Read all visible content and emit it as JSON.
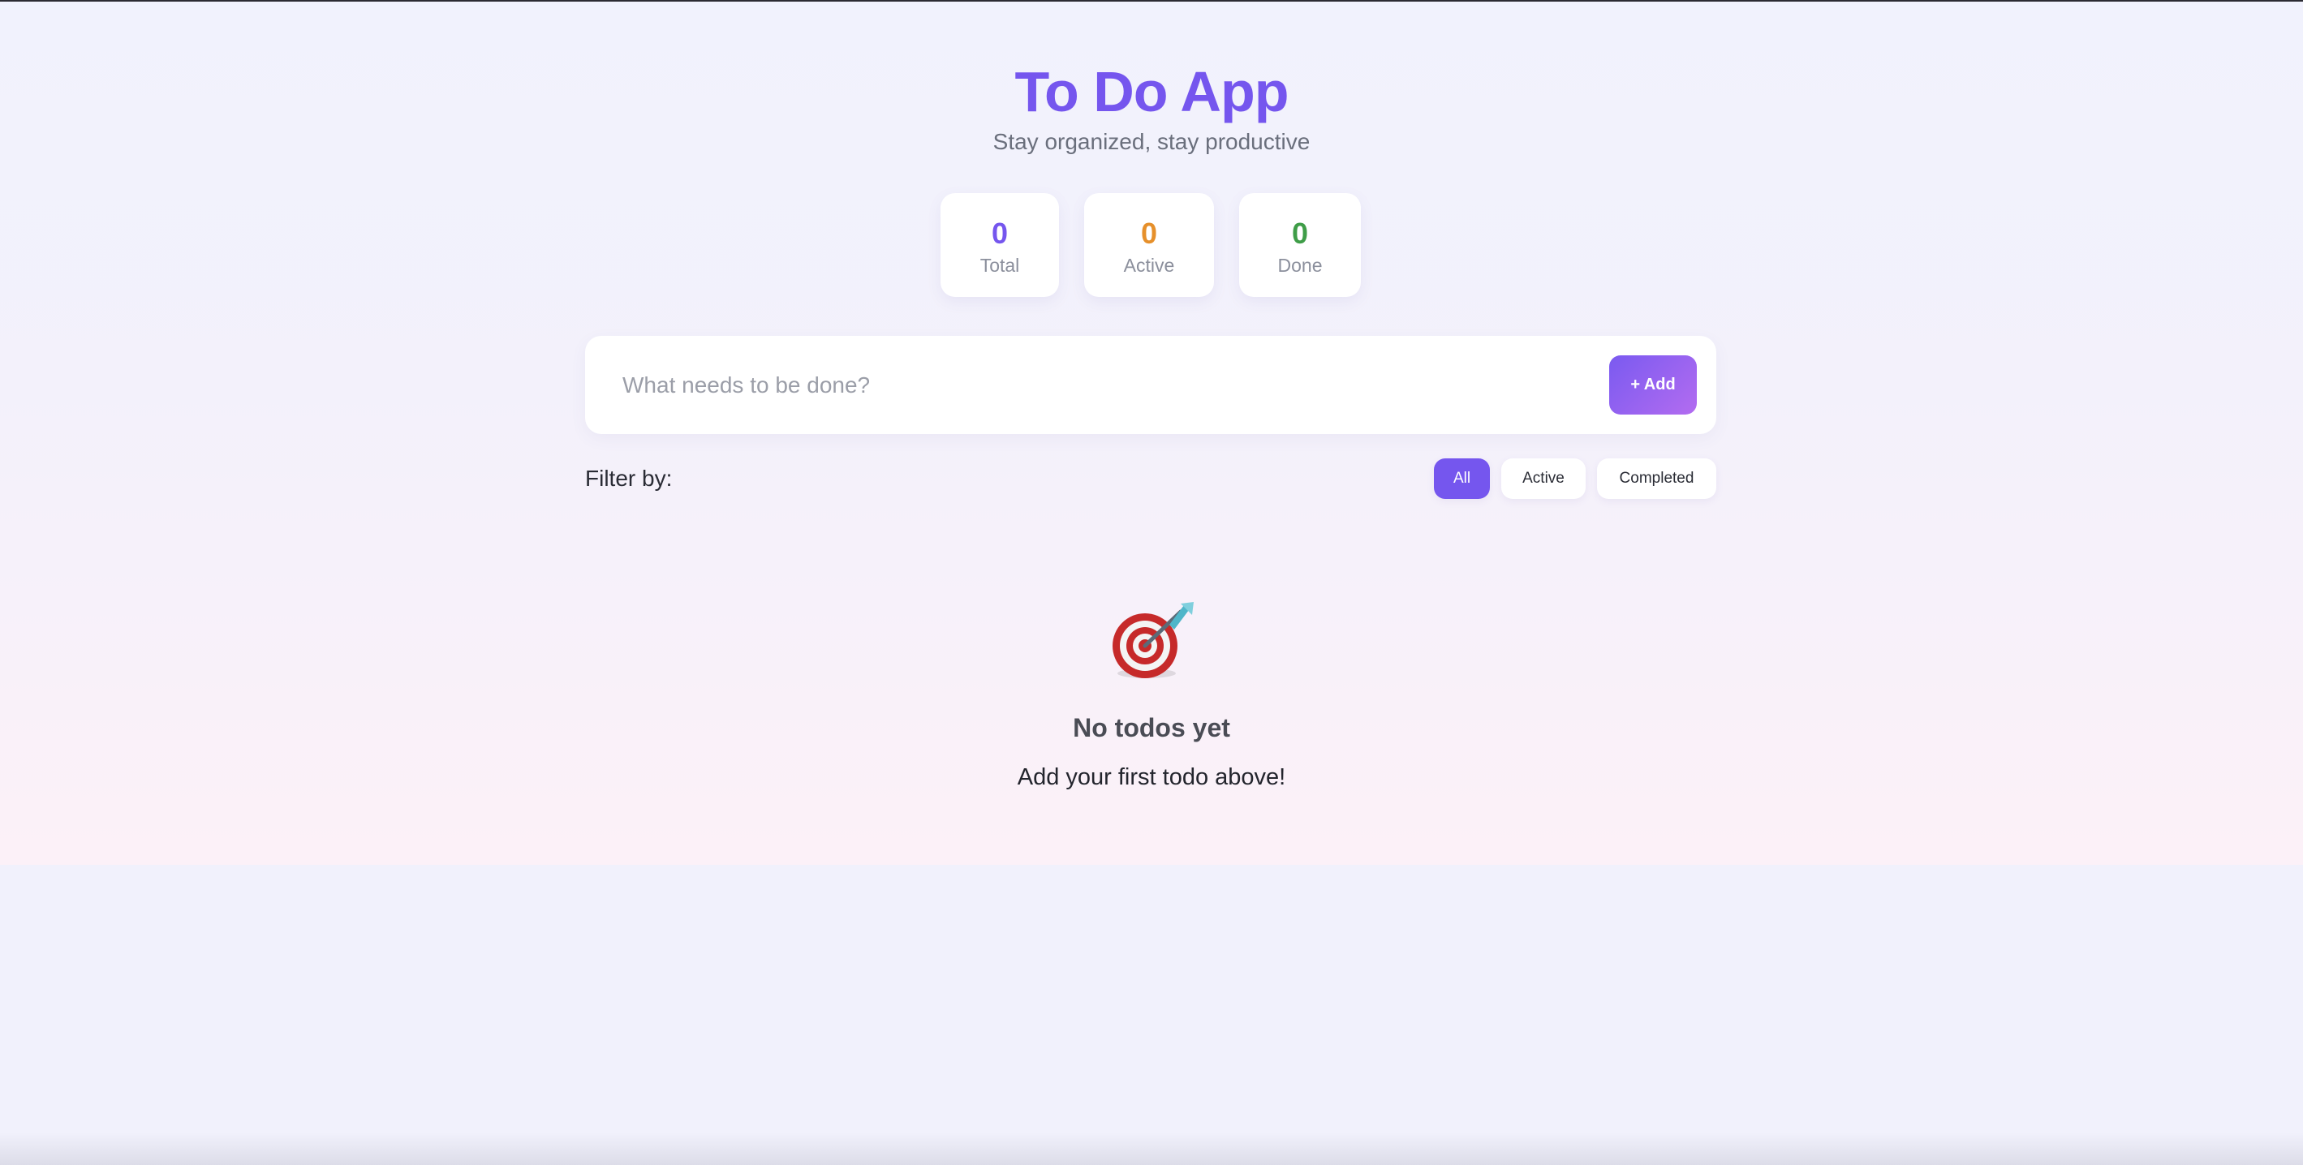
{
  "header": {
    "title": "To Do App",
    "subtitle": "Stay organized, stay productive"
  },
  "stats": [
    {
      "value": "0",
      "label": "Total",
      "color": "#7556ee"
    },
    {
      "value": "0",
      "label": "Active",
      "color": "#e6902b"
    },
    {
      "value": "0",
      "label": "Done",
      "color": "#3f9d48"
    }
  ],
  "add_todo": {
    "placeholder": "What needs to be done?",
    "value": "",
    "button_label": "+ Add"
  },
  "filter": {
    "label": "Filter by:",
    "options": [
      {
        "label": "All",
        "selected": true
      },
      {
        "label": "Active",
        "selected": false
      },
      {
        "label": "Completed",
        "selected": false
      }
    ]
  },
  "empty_state": {
    "icon": "dart-target-icon",
    "title": "No todos yet",
    "message": "Add your first todo above!"
  },
  "colors": {
    "accent": "#7556ee",
    "accent_gradient_end": "#b36cf0"
  }
}
